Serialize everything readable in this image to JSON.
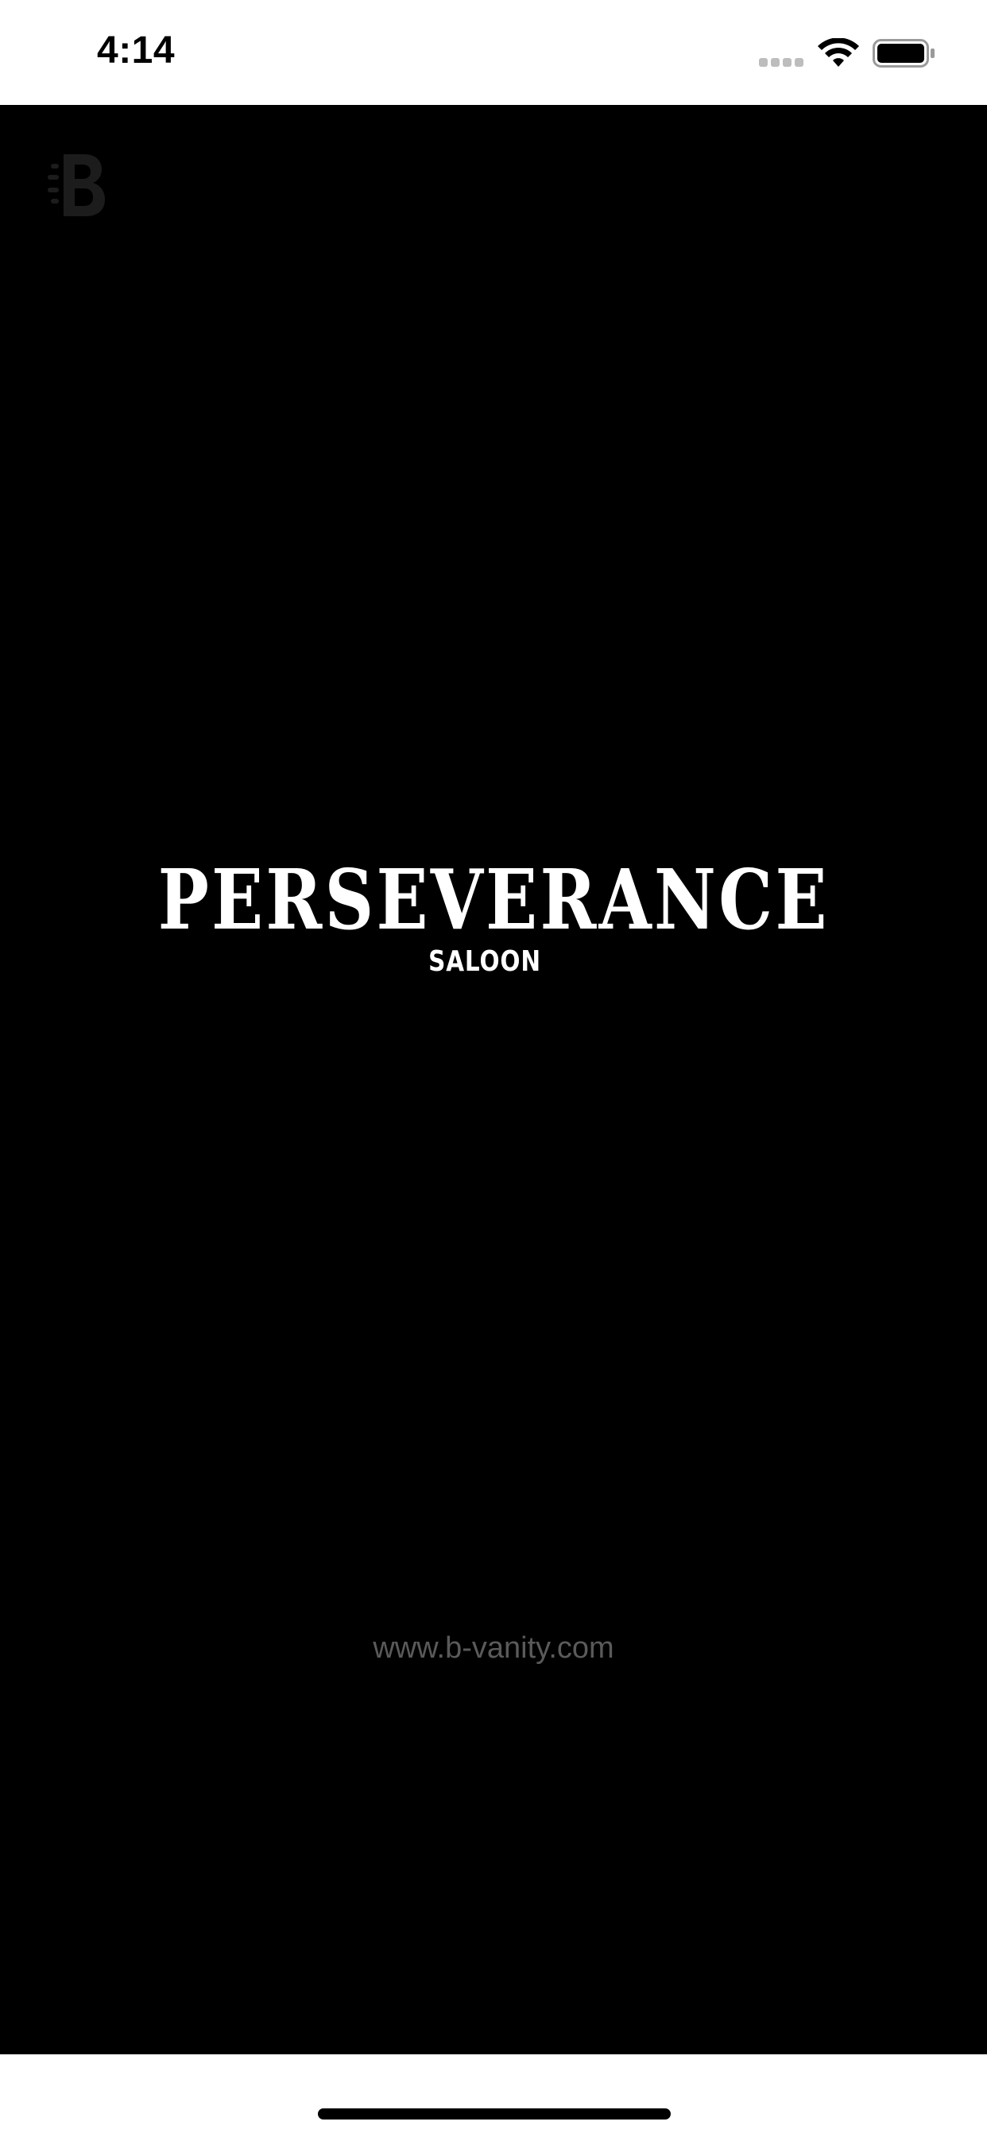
{
  "status_bar": {
    "time": "4:14",
    "icons": [
      "cellular-signal-icon",
      "wifi-icon",
      "battery-icon"
    ]
  },
  "splash": {
    "brand_mark_icon": "b-brand-logo-icon",
    "logo_title": "PERSEVERANCE",
    "logo_subtitle": "SALOON",
    "website": "www.b-vanity.com"
  },
  "colors": {
    "background": "#000000",
    "status_bar_bg": "#ffffff",
    "logo_text": "#ffffff",
    "website_text": "#5a5a5a",
    "brand_mark": "#1c1c1c"
  }
}
